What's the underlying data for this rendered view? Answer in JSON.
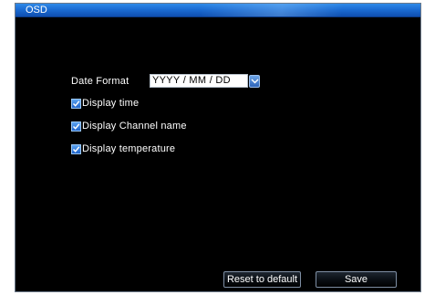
{
  "window": {
    "title": "OSD"
  },
  "date_format": {
    "label": "Date Format",
    "value": "YYYY / MM / DD"
  },
  "options": [
    {
      "label": "Display time",
      "checked": true
    },
    {
      "label": "Display Channel name",
      "checked": true
    },
    {
      "label": "Display temperature",
      "checked": true
    }
  ],
  "buttons": {
    "reset_label": "Reset to default",
    "save_label": "Save"
  },
  "colors": {
    "titlebar": "#1b6cd3",
    "background": "#000000",
    "checkbox": "#2d7be0"
  }
}
